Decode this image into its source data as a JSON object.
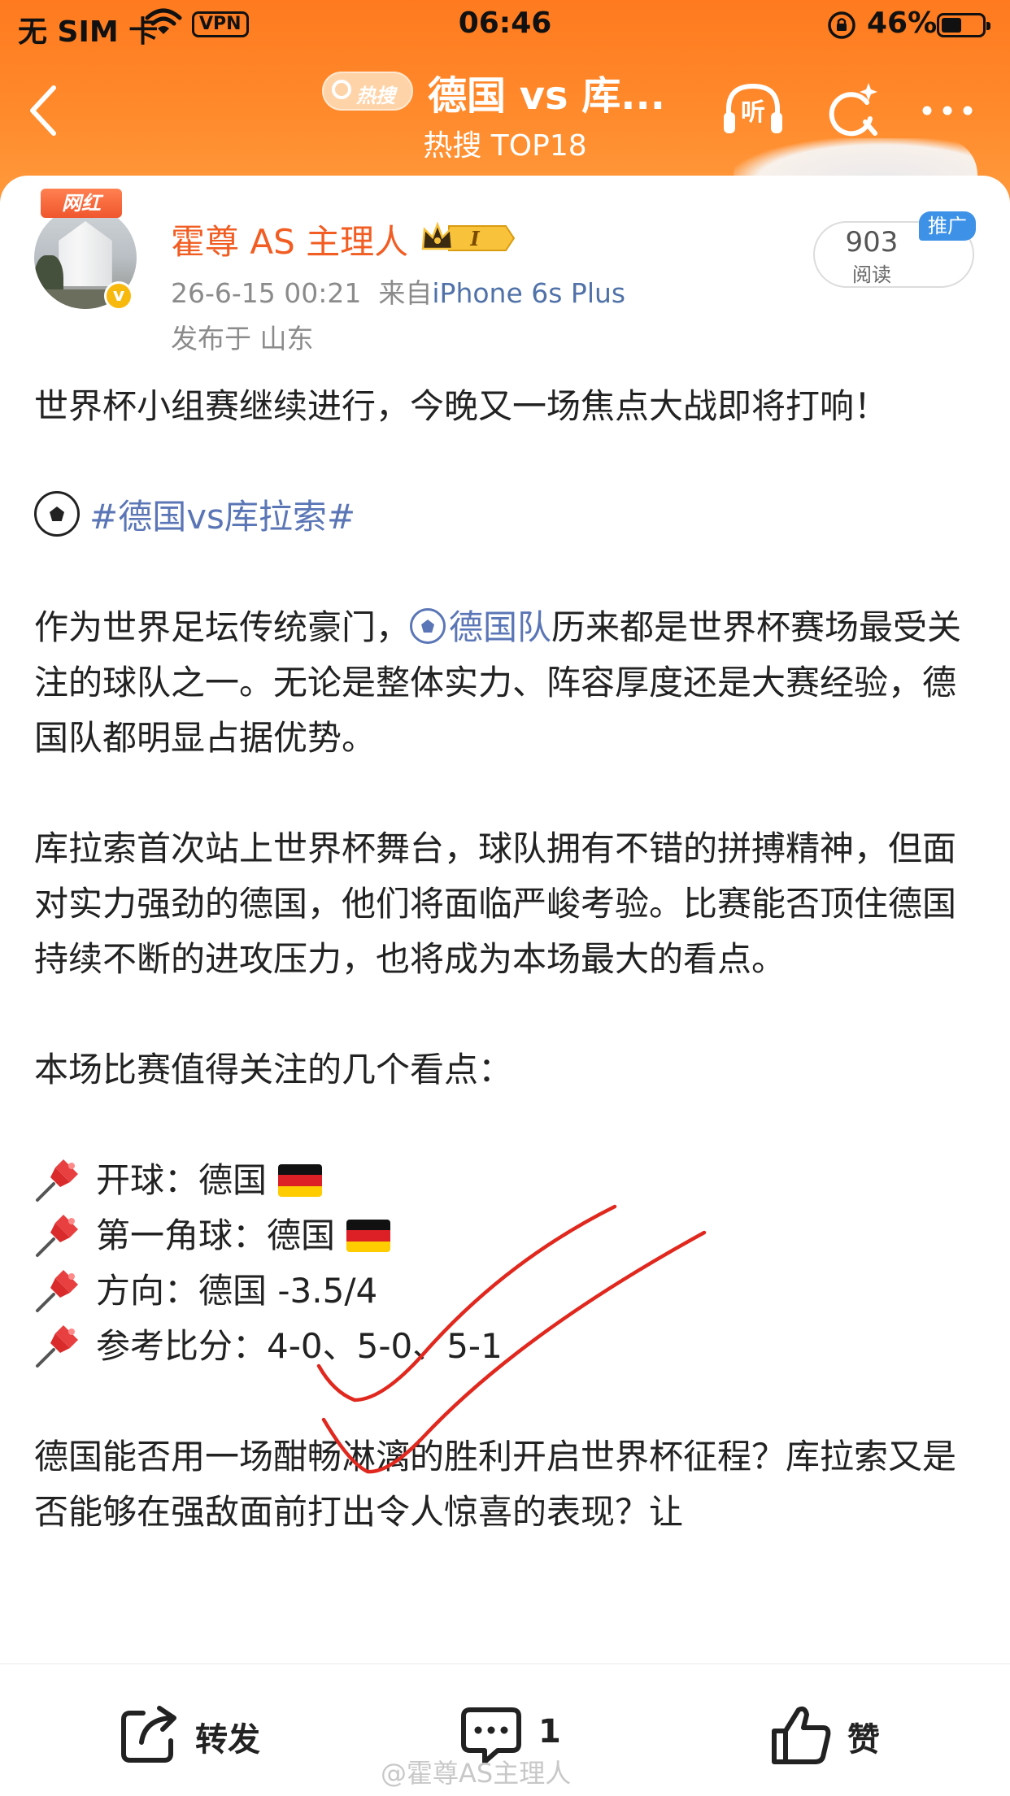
{
  "status_bar": {
    "carrier": "无 SIM 卡",
    "vpn": "VPN",
    "time": "06:46",
    "battery": "46%"
  },
  "nav": {
    "hot_badge": "热搜",
    "title": "德国 vs 库...",
    "subtitle": "热搜 TOP18",
    "listen_label": "听"
  },
  "post": {
    "badge": "网红",
    "verified_mark": "v",
    "username": "霍尊 AS 主理人",
    "level": "I",
    "time": "26-6-15 00:21",
    "source_prefix": "来自",
    "source": "iPhone 6s Plus",
    "location": "发布于 山东",
    "reads": "903",
    "reads_label": "阅读",
    "promo": "推广",
    "intro": "世界杯小组赛继续进行，今晚又一场焦点大战即将打响！",
    "hashtag": "#德国vs库拉索#",
    "para1_a": "作为世界足坛传统豪门，",
    "para1_link": "德国队",
    "para1_b": "历来都是世界杯赛场最受关注的球队之一。无论是整体实力、阵容厚度还是大赛经验，德国队都明显占据优势。",
    "para2": "库拉索首次站上世界杯舞台，球队拥有不错的拼搏精神，但面对实力强劲的德国，他们将面临严峻考验。比赛能否顶住德国持续不断的进攻压力，也将成为本场最大的看点。",
    "points_title": "本场比赛值得关注的几个看点：",
    "points": [
      {
        "label": "开球：",
        "value": "德国",
        "flag": true
      },
      {
        "label": "第一角球：",
        "value": "德国",
        "flag": true
      },
      {
        "label": "方向：",
        "value": "德国 -3.5/4",
        "flag": false
      },
      {
        "label": "参考比分：",
        "value": "4-0、5-0、5-1",
        "flag": false
      }
    ],
    "closing": "德国能否用一场酣畅淋漓的胜利开启世界杯征程？库拉索又是否能够在强敌面前打出令人惊喜的表现？让"
  },
  "footer": {
    "repost": "转发",
    "comments": "1",
    "like": "赞"
  },
  "watermark": "@霍尊AS主理人",
  "colors": {
    "header": "#ff7a1f",
    "username": "#f15d22",
    "link": "#5b76b6",
    "promo": "#3d92e8",
    "annotation": "#e0281e"
  }
}
